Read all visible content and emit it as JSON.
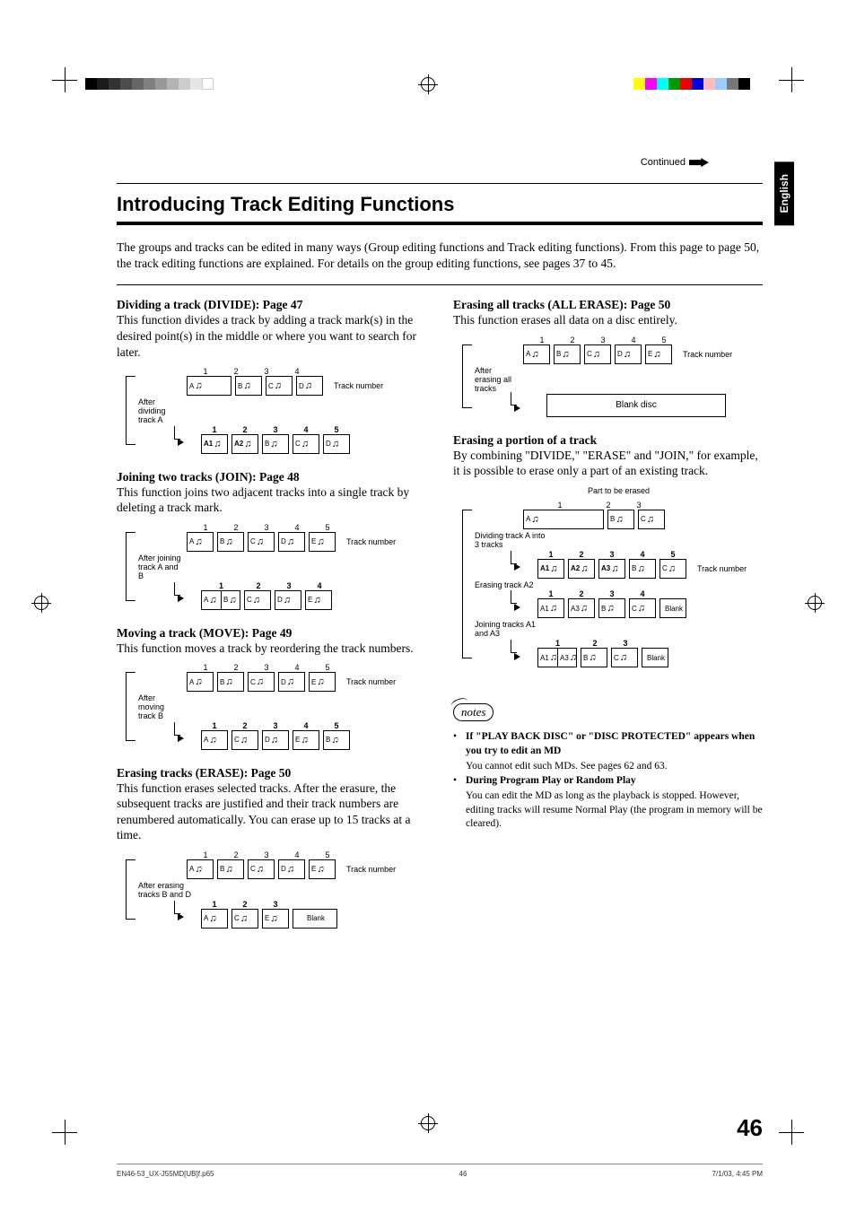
{
  "header": {
    "continued": "Continued",
    "language_tab": "English"
  },
  "title": "Introducing Track Editing Functions",
  "intro": "The groups and tracks can be edited in many ways (Group editing functions and Track editing functions). From this page to page 50, the track editing functions are explained. For details on the group editing functions, see pages 37 to 45.",
  "left": {
    "divide": {
      "title": "Dividing a track (DIVIDE): Page 47",
      "body": "This function divides a track by adding a track mark(s) in the desired point(s) in the middle or where you want to search for later.",
      "action_label": "After dividing track A",
      "tn_label": "Track number",
      "before_nums": [
        "1",
        "2",
        "3",
        "4"
      ],
      "before_boxes": [
        "A",
        "B",
        "C",
        "D"
      ],
      "after_nums": [
        "1",
        "2",
        "3",
        "4",
        "5"
      ],
      "after_boxes": [
        "A1",
        "A2",
        "B",
        "C",
        "D"
      ]
    },
    "join": {
      "title": "Joining two tracks (JOIN): Page 48",
      "body": "This function joins two adjacent tracks into a single track by deleting a track mark.",
      "action_label": "After joining track A and B",
      "tn_label": "Track number",
      "before_nums": [
        "1",
        "2",
        "3",
        "4",
        "5"
      ],
      "before_boxes": [
        "A",
        "B",
        "C",
        "D",
        "E"
      ],
      "after_nums": [
        "1",
        "2",
        "3",
        "4"
      ],
      "after_boxes": [
        "A",
        "B",
        "C",
        "D",
        "E"
      ]
    },
    "move": {
      "title": "Moving a track (MOVE): Page 49",
      "body": "This function moves a track by reordering the track numbers.",
      "action_label": "After moving track B",
      "tn_label": "Track number",
      "before_nums": [
        "1",
        "2",
        "3",
        "4",
        "5"
      ],
      "before_boxes": [
        "A",
        "B",
        "C",
        "D",
        "E"
      ],
      "after_nums": [
        "1",
        "2",
        "3",
        "4",
        "5"
      ],
      "after_boxes": [
        "A",
        "C",
        "D",
        "E",
        "B"
      ]
    },
    "erase": {
      "title": "Erasing tracks (ERASE): Page 50",
      "body": "This function erases selected tracks. After the erasure, the subsequent tracks are justified and their track numbers are renumbered automatically. You can erase up to 15 tracks at a time.",
      "action_label": "After erasing tracks B and D",
      "tn_label": "Track number",
      "before_nums": [
        "1",
        "2",
        "3",
        "4",
        "5"
      ],
      "before_boxes": [
        "A",
        "B",
        "C",
        "D",
        "E"
      ],
      "after_nums": [
        "1",
        "2",
        "3"
      ],
      "after_boxes": [
        "A",
        "C",
        "E",
        "Blank"
      ]
    }
  },
  "right": {
    "all_erase": {
      "title": "Erasing all tracks (ALL ERASE): Page 50",
      "body": "This function erases all data on a disc entirely.",
      "action_label": "After erasing all tracks",
      "tn_label": "Track number",
      "before_nums": [
        "1",
        "2",
        "3",
        "4",
        "5"
      ],
      "before_boxes": [
        "A",
        "B",
        "C",
        "D",
        "E"
      ],
      "result_label": "Blank disc"
    },
    "portion": {
      "title": "Erasing a portion of a track",
      "body": "By combining \"DIVIDE,\" \"ERASE\" and \"JOIN,\" for example, it is possible to erase only a part of an existing track.",
      "part_label": "Part to be erased",
      "tn_label": "Track number",
      "step1_label": "Dividing track A into 3 tracks",
      "step1_before_nums": [
        "1",
        "2",
        "3"
      ],
      "step1_before_boxes": [
        "A",
        "B",
        "C"
      ],
      "step1_after_nums": [
        "1",
        "2",
        "3",
        "4",
        "5"
      ],
      "step1_after_boxes": [
        "A1",
        "A2",
        "A3",
        "B",
        "C"
      ],
      "step2_label": "Erasing track A2",
      "step2_after_nums": [
        "1",
        "2",
        "3",
        "4"
      ],
      "step2_after_boxes": [
        "A1",
        "A3",
        "B",
        "C",
        "Blank"
      ],
      "step3_label": "Joining tracks A1 and A3",
      "step3_after_nums": [
        "1",
        "2",
        "3"
      ],
      "step3_after_boxes": [
        "A1",
        "A3",
        "B",
        "C",
        "Blank"
      ]
    },
    "notes": {
      "icon_text": "notes",
      "items": [
        {
          "bold": "If \"PLAY BACK DISC\" or \"DISC PROTECTED\" appears when you try to edit an MD",
          "desc": "You cannot edit such MDs. See pages 62 and 63."
        },
        {
          "bold": "During Program Play or Random Play",
          "desc": "You can edit the MD as long as the playback is stopped. However, editing tracks will resume Normal Play (the program in memory will be cleared)."
        }
      ]
    }
  },
  "page_number": "46",
  "footer": {
    "left": "EN46-53_UX-J55MD[UB]f.p65",
    "center": "46",
    "right": "7/1/03, 4:45 PM"
  }
}
